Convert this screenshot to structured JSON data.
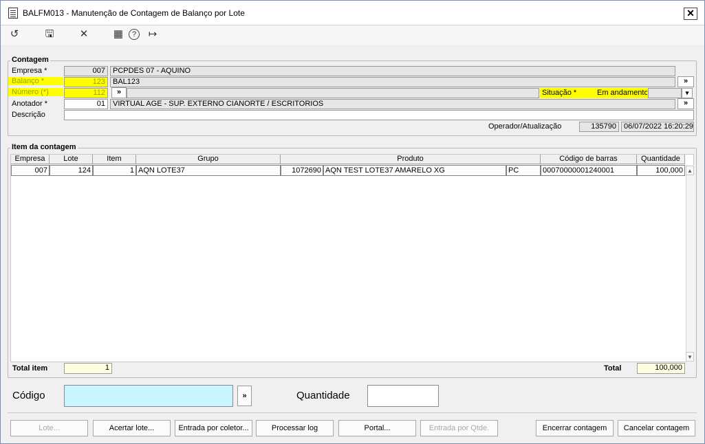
{
  "window": {
    "title": "BALFM013 - Manutenção de Contagem de Balanço por Lote",
    "close_label": "✕"
  },
  "toolbar": {
    "icons": [
      "undo-icon",
      "save-icon",
      "cancel-icon",
      "calendar-icon",
      "help-icon",
      "exit-icon"
    ],
    "undo_glyph": "↺",
    "save_glyph": "🖫",
    "cancel_glyph": "✕",
    "calendar_glyph": "▦",
    "help_glyph": "?",
    "exit_glyph": "↦"
  },
  "contagem": {
    "group_label": "Contagem",
    "empresa_label": "Empresa *",
    "empresa_code": "007",
    "empresa_name": "PCPDES 07 - AQUINO",
    "balanco_label": "Balanço *",
    "balanco_code": "123",
    "balanco_name": "BAL123",
    "numero_label": "Número (*)",
    "numero_value": "112",
    "situacao_label": "Situação *",
    "situacao_value": "Em andamento",
    "anotador_label": "Anotador *",
    "anotador_code": "01",
    "anotador_name": "VIRTUAL AGE - SUP. EXTERNO CIANORTE / ESCRITORIOS",
    "descricao_label": "Descrição",
    "descricao_value": "",
    "operador_label": "Operador/Atualização",
    "operador_value": "135790",
    "atualizacao_value": "06/07/2022 16:20:29",
    "lookup_label": "»",
    "dropdown_label": "▾"
  },
  "itens": {
    "group_label": "Item da contagem",
    "columns": [
      "Empresa",
      "Lote",
      "Item",
      "Grupo",
      "Produto",
      "Código de barras",
      "Quantidade"
    ],
    "rows": [
      {
        "empresa": "007",
        "lote": "124",
        "item": "1",
        "grupo": "AQN LOTE37",
        "produto_code": "1072690",
        "produto_name": "AQN TEST LOTE37 AMARELO XG",
        "unidade": "PC",
        "codigo_barras": "00070000001240001",
        "quantidade": "100,000"
      }
    ],
    "scroll_up": "▲",
    "scroll_down": "▼",
    "total_item_label": "Total item",
    "total_item_value": "1",
    "total_label": "Total",
    "total_value": "100,000"
  },
  "entrada": {
    "codigo_label": "Código",
    "codigo_value": "",
    "lookup_label": "»",
    "quantidade_label": "Quantidade",
    "quantidade_value": ""
  },
  "buttons": {
    "lote": "Lote...",
    "acertar_lote": "Acertar lote...",
    "entrada_coletor": "Entrada por coletor...",
    "processar_log": "Processar log",
    "portal": "Portal...",
    "entrada_qtde": "Entrada por Qtde.",
    "encerrar": "Encerrar contagem",
    "cancelar": "Cancelar contagem"
  },
  "colors": {
    "highlight": "#ffff00",
    "codigo_field": "#c8f6ff",
    "total_field": "#fffde0"
  }
}
